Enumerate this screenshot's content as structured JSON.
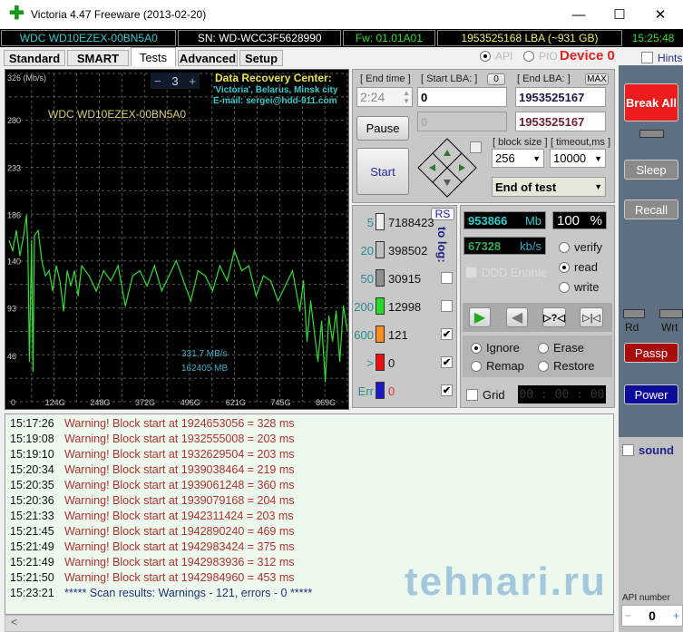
{
  "window": {
    "title": "Victoria 4.47  Freeware (2013-02-20)",
    "minimize": "—",
    "maximize": "☐",
    "close": "✕"
  },
  "infobar": {
    "model": "WDC WD10EZEX-00BN5A0",
    "serial": "SN: WD-WCC3F5628990",
    "firmware": "Fw: 01.01A01",
    "capacity": "1953525168 LBA (~931 GB)",
    "clock": "15:25:48"
  },
  "tabs": [
    {
      "label": "Standard"
    },
    {
      "label": "SMART"
    },
    {
      "label": "Tests",
      "active": true
    },
    {
      "label": "Advanced"
    },
    {
      "label": "Setup"
    }
  ],
  "mode": {
    "api": "API",
    "pio": "PIO",
    "device": "Device 0",
    "hints": "Hints"
  },
  "chart_data": {
    "type": "line",
    "ylabel": "326 (Mb/s)",
    "yticks": [
      "326 (Mb/s)",
      "280",
      "233",
      "186",
      "140",
      "93",
      "46",
      "0"
    ],
    "xticks": [
      "0",
      "124G",
      "248G",
      "372G",
      "496G",
      "621G",
      "745G",
      "869G"
    ],
    "ylim": [
      0,
      326
    ],
    "xlim": [
      0,
      931
    ],
    "grid": true,
    "color": "#33dd33",
    "x": [
      0,
      10,
      20,
      30,
      40,
      48,
      52,
      56,
      62,
      66,
      70,
      80,
      90,
      100,
      110,
      120,
      130,
      140,
      150,
      160,
      170,
      180,
      190,
      200,
      220,
      240,
      260,
      280,
      300,
      320,
      340,
      360,
      380,
      400,
      420,
      440,
      460,
      480,
      500,
      520,
      540,
      560,
      580,
      600,
      620,
      640,
      660,
      680,
      700,
      720,
      740,
      760,
      780,
      800,
      810,
      820,
      830,
      840,
      850,
      860,
      870,
      880,
      890,
      900,
      910,
      920,
      931
    ],
    "values": [
      160,
      150,
      170,
      145,
      165,
      185,
      150,
      40,
      160,
      30,
      165,
      170,
      140,
      125,
      130,
      110,
      135,
      120,
      90,
      130,
      115,
      130,
      105,
      135,
      125,
      110,
      130,
      120,
      135,
      95,
      125,
      130,
      115,
      135,
      110,
      125,
      140,
      120,
      100,
      130,
      125,
      110,
      135,
      120,
      150,
      130,
      135,
      105,
      125,
      120,
      100,
      115,
      130,
      90,
      120,
      60,
      100,
      70,
      40,
      80,
      20,
      85,
      60,
      90,
      40,
      95,
      70
    ],
    "speed_readout": "331,7 MB/s",
    "mb_readout": "162405 MB",
    "model_label": "WDC WD10EZEX-00BN5A0",
    "zoom_minus": "−",
    "zoom_value": "3",
    "zoom_plus": "+",
    "drc_title": "Data Recovery Center:",
    "drc_line1": "'Victoria', Belarus, Minsk city",
    "drc_line2": "E-mail: sergei@hdd-911.com"
  },
  "controls": {
    "end_time_label": "[ End time ]",
    "end_time": "2:24",
    "start_lba_label": "[ Start LBA: ]",
    "start_lba_btn": "0",
    "end_lba_label": "[ End LBA: ]",
    "max_btn": "MAX",
    "start_lba": "0",
    "end_lba": "1953525167",
    "cur_lba": "0",
    "end_lba2": "1953525167",
    "pause": "Pause",
    "start": "Start",
    "block_size_label": "[ block size ]",
    "timeout_label": "[ timeout,ms ]",
    "block_size": "256",
    "timeout": "10000",
    "end_action": "End of test"
  },
  "stats": {
    "rs": "RS",
    "to_log": "to log:",
    "rows": [
      {
        "threshold": "5",
        "count": "7188423",
        "color": "#f0f0f0",
        "log": null
      },
      {
        "threshold": "20",
        "count": "398502",
        "color": "#c0c0c0",
        "log": null
      },
      {
        "threshold": "50",
        "count": "30915",
        "color": "#909090",
        "log": false
      },
      {
        "threshold": "200",
        "count": "12998",
        "color": "#22dd22",
        "log": false
      },
      {
        "threshold": "600",
        "count": "121",
        "color": "#ff8c1a",
        "log": true
      },
      {
        "threshold": ">",
        "count": "0",
        "color": "#ee1111",
        "log": true
      },
      {
        "threshold": "Err",
        "count": "0",
        "color": "#1a1acc",
        "log": true
      }
    ]
  },
  "progress": {
    "mb": "953866",
    "mb_unit": "Mb",
    "percent": "100",
    "percent_unit": "%",
    "speed": "67328",
    "speed_unit": "kb/s",
    "ddd": "DDD Enable",
    "verify": "verify",
    "read": "read",
    "write": "write",
    "selected": "read",
    "play_icons": [
      "▶",
      "◀",
      "▷?◁",
      "▷|◁"
    ],
    "ignore": "Ignore",
    "erase": "Erase",
    "remap": "Remap",
    "restore": "Restore",
    "action": "Ignore",
    "grid": "Grid",
    "timer": "00 : 00 : 00"
  },
  "side": {
    "break_all": "Break All",
    "sleep": "Sleep",
    "recall": "Recall",
    "rd": "Rd",
    "wrt": "Wrt",
    "passp": "Passp",
    "power": "Power",
    "sound": "sound",
    "api_number_label": "API number",
    "api_minus": "−",
    "api_number": "0",
    "api_plus": "+"
  },
  "log": [
    {
      "time": "15:17:26",
      "msg": "Warning! Block start at 1924653056 = 328 ms",
      "type": "warn"
    },
    {
      "time": "15:19:08",
      "msg": "Warning! Block start at 1932555008 = 203 ms",
      "type": "warn"
    },
    {
      "time": "15:19:10",
      "msg": "Warning! Block start at 1932629504 = 203 ms",
      "type": "warn"
    },
    {
      "time": "15:20:34",
      "msg": "Warning! Block start at 1939038464 = 219 ms",
      "type": "warn"
    },
    {
      "time": "15:20:35",
      "msg": "Warning! Block start at 1939061248 = 360 ms",
      "type": "warn"
    },
    {
      "time": "15:20:36",
      "msg": "Warning! Block start at 1939079168 = 204 ms",
      "type": "warn"
    },
    {
      "time": "15:21:33",
      "msg": "Warning! Block start at 1942311424 = 203 ms",
      "type": "warn"
    },
    {
      "time": "15:21:45",
      "msg": "Warning! Block start at 1942890240 = 469 ms",
      "type": "warn"
    },
    {
      "time": "15:21:49",
      "msg": "Warning! Block start at 1942983424 = 375 ms",
      "type": "warn"
    },
    {
      "time": "15:21:49",
      "msg": "Warning! Block start at 1942983936 = 312 ms",
      "type": "warn"
    },
    {
      "time": "15:21:50",
      "msg": "Warning! Block start at 1942984960 = 453 ms",
      "type": "warn"
    },
    {
      "time": "15:23:21",
      "msg": "***** Scan results: Warnings - 121, errors - 0 *****",
      "type": "info"
    }
  ],
  "watermark": "tehnari.ru",
  "scroll_left": "<"
}
